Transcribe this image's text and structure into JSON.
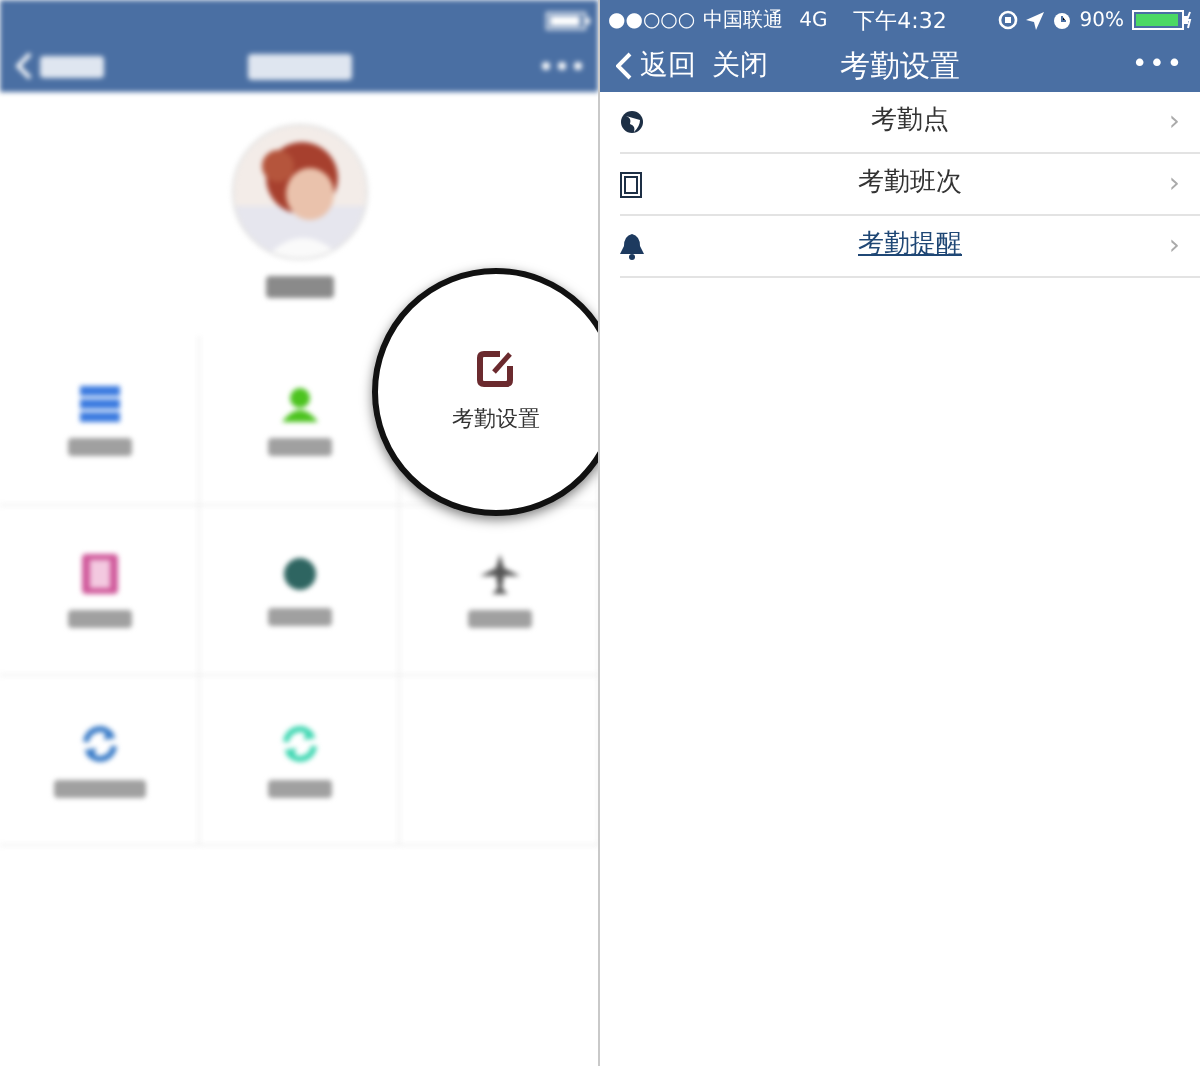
{
  "left_screen": {
    "tiles": [
      {
        "magnified": false
      },
      {
        "magnified": false
      },
      {
        "label": "考勤设置",
        "magnified": true
      },
      {
        "magnified": false
      },
      {
        "magnified": false
      },
      {
        "magnified": false
      },
      {
        "magnified": false
      },
      {
        "magnified": false
      }
    ]
  },
  "right_screen": {
    "status_bar": {
      "signal": "●●○○○",
      "carrier": "中国联通",
      "network": "4G",
      "time": "下午4:32",
      "battery": "90%"
    },
    "nav": {
      "back": "返回",
      "close": "关闭",
      "title": "考勤设置",
      "more": "•••"
    },
    "items": [
      {
        "label": "考勤点",
        "chevron": "›",
        "link": false
      },
      {
        "label": "考勤班次",
        "chevron": "›",
        "link": false
      },
      {
        "label": "考勤提醒",
        "chevron": "›",
        "link": true
      }
    ]
  }
}
